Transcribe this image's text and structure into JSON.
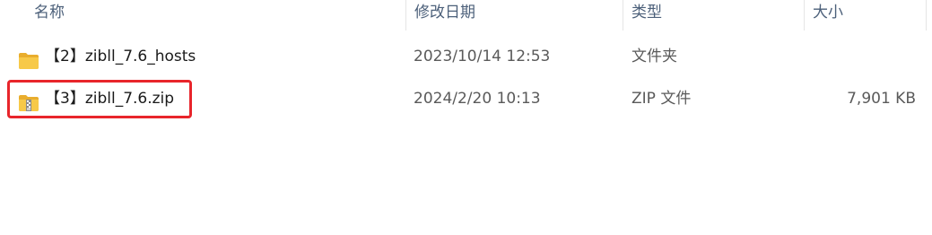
{
  "columns": {
    "name": "名称",
    "modified": "修改日期",
    "type": "类型",
    "size": "大小"
  },
  "files": [
    {
      "name": "【2】zibll_7.6_hosts",
      "modified": "2023/10/14 12:53",
      "type": "文件夹",
      "size": "",
      "icon": "folder-icon"
    },
    {
      "name": "【3】zibll_7.6.zip",
      "modified": "2024/2/20 10:13",
      "type": "ZIP 文件",
      "size": "7,901 KB",
      "icon": "zip-folder-icon"
    }
  ],
  "colors": {
    "folder": "#f5c542",
    "highlight": "#e8252b",
    "header_text": "#4c607a"
  }
}
